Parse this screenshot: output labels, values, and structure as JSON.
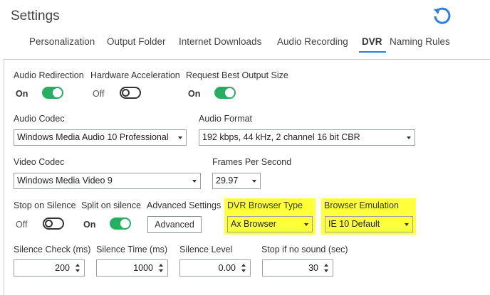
{
  "app": {
    "title": "Settings",
    "refresh_icon": "refresh-icon",
    "accent": "#2f7ed8"
  },
  "tabs": [
    {
      "label": "Personalization"
    },
    {
      "label": "Output Folder"
    },
    {
      "label": "Internet Downloads"
    },
    {
      "label": "Audio Recording"
    },
    {
      "label": "DVR",
      "active": true
    },
    {
      "label": "Naming Rules"
    }
  ],
  "dvr": {
    "audio_redirection": {
      "label": "Audio Redirection",
      "state": "On"
    },
    "hardware_acceleration": {
      "label": "Hardware Acceleration",
      "state": "Off"
    },
    "request_best_output": {
      "label": "Request Best Output Size",
      "state": "On"
    },
    "audio_codec": {
      "label": "Audio Codec",
      "value": "Windows Media Audio 10 Professional"
    },
    "audio_format": {
      "label": "Audio Format",
      "value": "192 kbps, 44 kHz, 2 channel 16 bit CBR"
    },
    "video_codec": {
      "label": "Video Codec",
      "value": "Windows Media Video 9"
    },
    "frames_per_second": {
      "label": "Frames Per Second",
      "value": "29.97"
    },
    "stop_on_silence": {
      "label": "Stop on Silence",
      "state": "Off"
    },
    "split_on_silence": {
      "label": "Split on silence",
      "state": "On"
    },
    "advanced_settings": {
      "label": "Advanced Settings",
      "button": "Advanced"
    },
    "dvr_browser_type": {
      "label": "DVR Browser Type",
      "value": "Ax Browser"
    },
    "browser_emulation": {
      "label": "Browser Emulation",
      "value": "IE 10 Default"
    },
    "silence_check": {
      "label": "Silence Check (ms)",
      "value": "200"
    },
    "silence_time": {
      "label": "Silence Time (ms)",
      "value": "1000"
    },
    "silence_level": {
      "label": "Silence Level",
      "value": "0.00"
    },
    "stop_if_no_sound": {
      "label": "Stop if no sound (sec)",
      "value": "30"
    }
  },
  "colors": {
    "toggle_on": "#27ae60",
    "highlight": "#ffff3c"
  }
}
